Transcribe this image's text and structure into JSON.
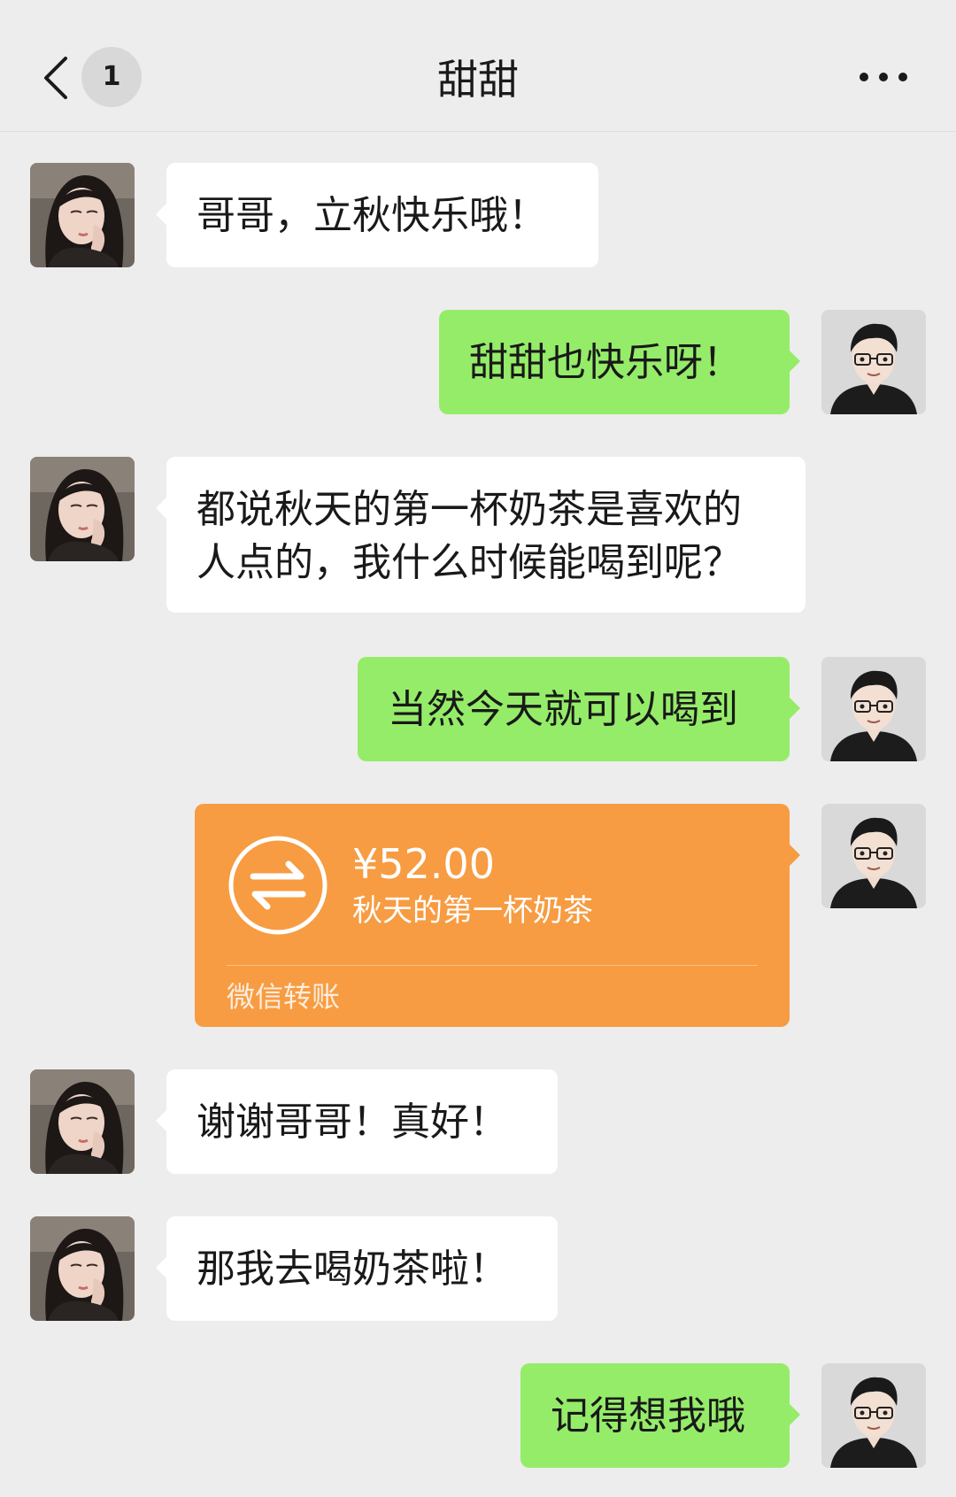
{
  "header": {
    "back_label": "",
    "unread_count": "1",
    "title": "甜甜",
    "more_icon": "more-horizontal-icon"
  },
  "messages": [
    {
      "sender": "甜甜",
      "direction": "incoming",
      "type": "text",
      "lines": [
        "哥哥，立秋快乐哦！"
      ]
    },
    {
      "sender": "me",
      "direction": "outgoing",
      "type": "text",
      "lines": [
        "甜甜也快乐呀！"
      ]
    },
    {
      "sender": "甜甜",
      "direction": "incoming",
      "type": "text",
      "lines": [
        "都说秋天的第一杯奶茶是喜欢的",
        "人点的，我什么时候能喝到呢？"
      ]
    },
    {
      "sender": "me",
      "direction": "outgoing",
      "type": "text",
      "lines": [
        "当然今天就可以喝到"
      ]
    },
    {
      "sender": "me",
      "direction": "outgoing",
      "type": "transfer",
      "amount": "¥52.00",
      "note": "秋天的第一杯奶茶",
      "footer": "微信转账",
      "icon": "transfer-arrows-icon"
    },
    {
      "sender": "甜甜",
      "direction": "incoming",
      "type": "text",
      "lines": [
        "谢谢哥哥！真好！"
      ]
    },
    {
      "sender": "甜甜",
      "direction": "incoming",
      "type": "text",
      "lines": [
        "那我去喝奶茶啦！"
      ]
    },
    {
      "sender": "me",
      "direction": "outgoing",
      "type": "text",
      "lines": [
        "记得想我哦"
      ]
    }
  ],
  "colors": {
    "background": "#ededed",
    "incoming_bubble": "#ffffff",
    "outgoing_bubble": "#95ec69",
    "transfer_card": "#f79c42",
    "text": "#191919"
  }
}
